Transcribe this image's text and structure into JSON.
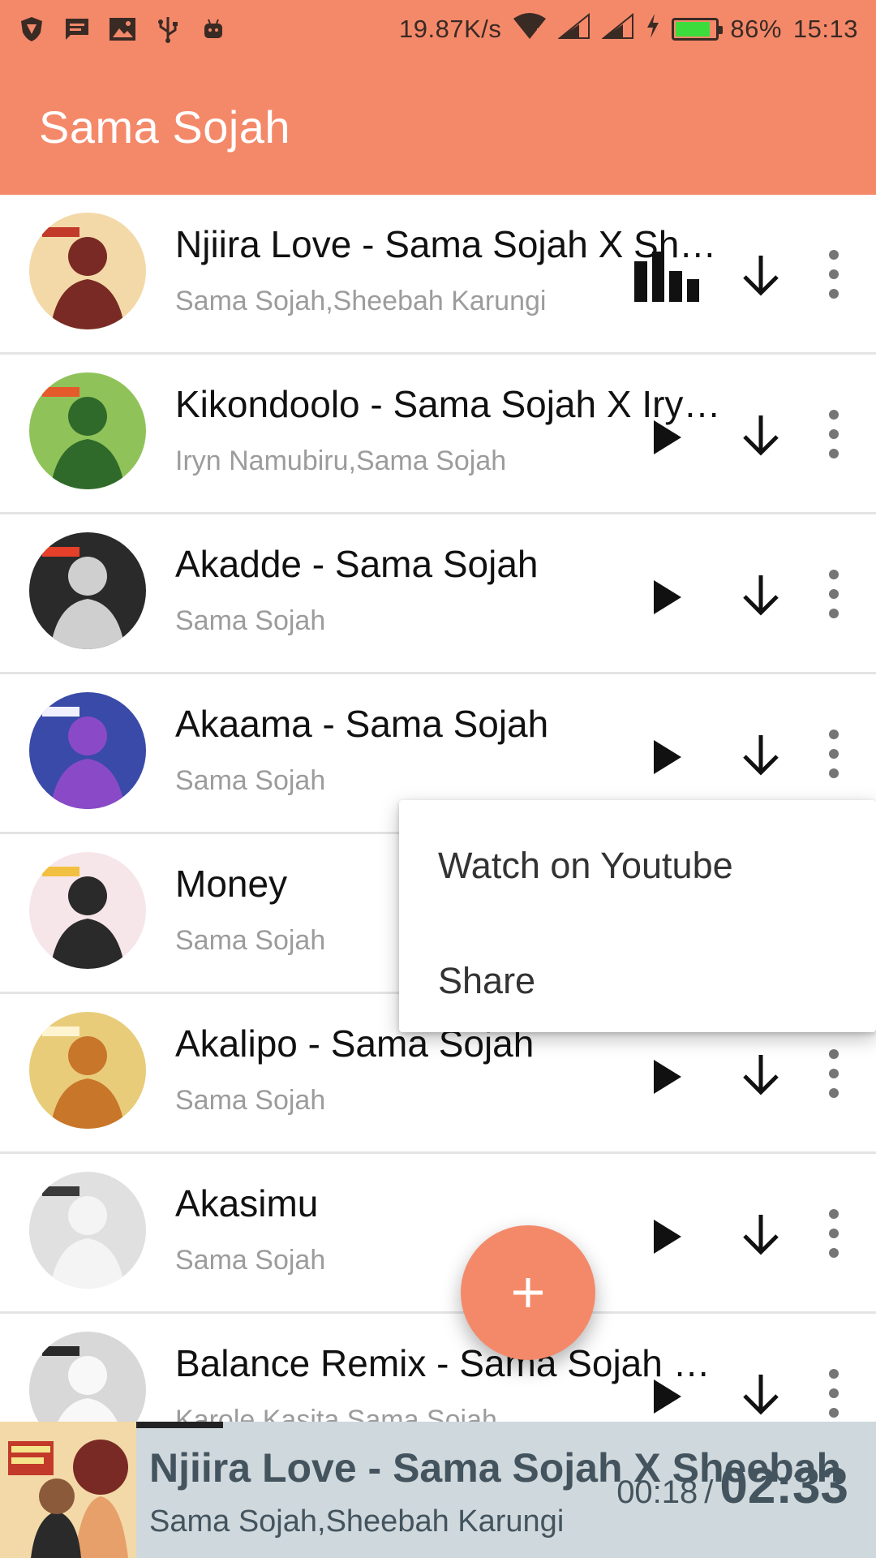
{
  "status_bar": {
    "network_speed": "19.87K/s",
    "battery_percent": "86%",
    "battery_level": 0.86,
    "time": "15:13",
    "left_icons": [
      "shield-icon",
      "message-icon",
      "image-icon",
      "usb-icon",
      "android-icon"
    ]
  },
  "app_bar": {
    "title": "Sama Sojah"
  },
  "songs": [
    {
      "title": "Njiira Love - Sama Sojah X Sheebah",
      "artist": "Sama Sojah,Sheebah Karungi",
      "state": "playing"
    },
    {
      "title": "Kikondoolo - Sama Sojah X Iryn Namubiru",
      "artist": "Iryn Namubiru,Sama Sojah",
      "state": "idle"
    },
    {
      "title": "Akadde - Sama Sojah",
      "artist": "Sama Sojah",
      "state": "idle"
    },
    {
      "title": "Akaama - Sama Sojah",
      "artist": "Sama Sojah",
      "state": "idle"
    },
    {
      "title": "Money",
      "artist": "Sama Sojah",
      "state": "idle"
    },
    {
      "title": "Akalipo - Sama Sojah",
      "artist": "Sama Sojah",
      "state": "idle"
    },
    {
      "title": "Akasimu",
      "artist": "Sama Sojah",
      "state": "idle"
    },
    {
      "title": "Balance Remix - Sama Sojah X Karole Kasita",
      "artist": "Karole Kasita,Sama Sojah",
      "state": "idle"
    }
  ],
  "menu": {
    "items": [
      "Watch on Youtube",
      "Share"
    ]
  },
  "now_playing": {
    "title": "Njiira Love - Sama Sojah X Sheebah",
    "artist": "Sama Sojah,Sheebah Karungi",
    "elapsed": "00:18",
    "separator": "/",
    "total": "02:33"
  },
  "colors": {
    "accent": "#f4896a",
    "player_bg": "#cfd8dc",
    "player_text": "#44545e"
  }
}
